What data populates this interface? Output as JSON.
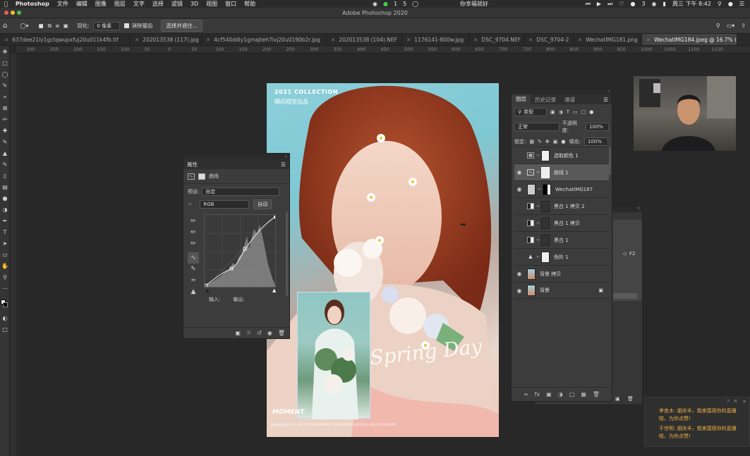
{
  "menubar": {
    "app": "Photoshop",
    "items": [
      "文件",
      "编辑",
      "图像",
      "图层",
      "文字",
      "选择",
      "滤镜",
      "3D",
      "视图",
      "窗口",
      "帮助"
    ],
    "center_text": "你幸福就好",
    "clock": "周三 下午 8:42",
    "badge_a": "1",
    "badge_b": "5",
    "badge_c": "3"
  },
  "window": {
    "title": "Adobe Photoshop 2020"
  },
  "options_bar": {
    "feather_label": "羽化:",
    "feather_value": "0 像素",
    "antialias_label": "消除锯齿",
    "select_mask_button": "选择并遮住..."
  },
  "tabs": [
    {
      "label": "637dee21ly1gctqwupxfuj20u011k4fb.tif"
    },
    {
      "label": "202013538 (117).jpg"
    },
    {
      "label": "4cf540ddly1gmajteh7lvj20u0190b2r.jpg"
    },
    {
      "label": "202013538 (104).NEF"
    },
    {
      "label": "1176141-800w.jpg"
    },
    {
      "label": "DSC_9704.NEF"
    },
    {
      "label": "DSC_9704-2"
    },
    {
      "label": "WechatIMG181.png"
    },
    {
      "label": "WechatIMG184.jpeg @ 16.7% (曲"
    }
  ],
  "ruler_ticks": [
    "300",
    "250",
    "200",
    "150",
    "100",
    "50",
    "0",
    "50",
    "100",
    "150",
    "200",
    "250",
    "300",
    "350",
    "400",
    "450",
    "500",
    "550",
    "600",
    "650",
    "700",
    "750",
    "800",
    "850",
    "900",
    "950",
    "1000",
    "1050",
    "1100",
    "1150"
  ],
  "canvas": {
    "headline": "2021 COLLECTION",
    "subline": "瞬间视觉出品",
    "script_text": "Spring Day",
    "moment_text": "MOMENT",
    "small_print": "瞬间视觉出品 2021 COLLECTION COPYRIGHT RESERVED BY VISION ALL RIGHTS RESERVED"
  },
  "properties": {
    "title": "属性",
    "adjust_name": "曲线",
    "preset_label": "预设:",
    "preset_value": "自定",
    "channel_value": "RGB",
    "auto_button": "自动",
    "input_label": "输入:",
    "output_label": "输出:"
  },
  "layers_panel": {
    "tabs": [
      "图层",
      "历史记录",
      "通道"
    ],
    "filter_value": "类型",
    "blend_mode": "正常",
    "opacity_label": "不透明度:",
    "opacity_value": "100%",
    "lock_label": "锁定:",
    "fill_label": "填充:",
    "fill_value": "100%",
    "layers": [
      {
        "name": "选取颜色 1",
        "visible": false,
        "selected": false
      },
      {
        "name": "曲线 1",
        "visible": true,
        "selected": true
      },
      {
        "name": "WechatIMG187",
        "visible": true,
        "selected": false
      },
      {
        "name": "黑白 1 拷贝 2",
        "visible": false,
        "selected": false
      },
      {
        "name": "黑白 1 拷贝",
        "visible": false,
        "selected": false
      },
      {
        "name": "黑白 1",
        "visible": false,
        "selected": false
      },
      {
        "name": "色阶 1",
        "visible": false,
        "selected": false
      },
      {
        "name": "背景 拷贝",
        "visible": true,
        "selected": false
      },
      {
        "name": "背景",
        "visible": true,
        "selected": false
      }
    ]
  },
  "back_panel": {
    "shortcut": "F2"
  },
  "chat": {
    "lines": [
      "李良木: 朋庆丰，我来围观你的直播啦，为你点赞!",
      "于世明: 朋庆丰，我来围观你的直播啦，为你点赞!"
    ]
  }
}
